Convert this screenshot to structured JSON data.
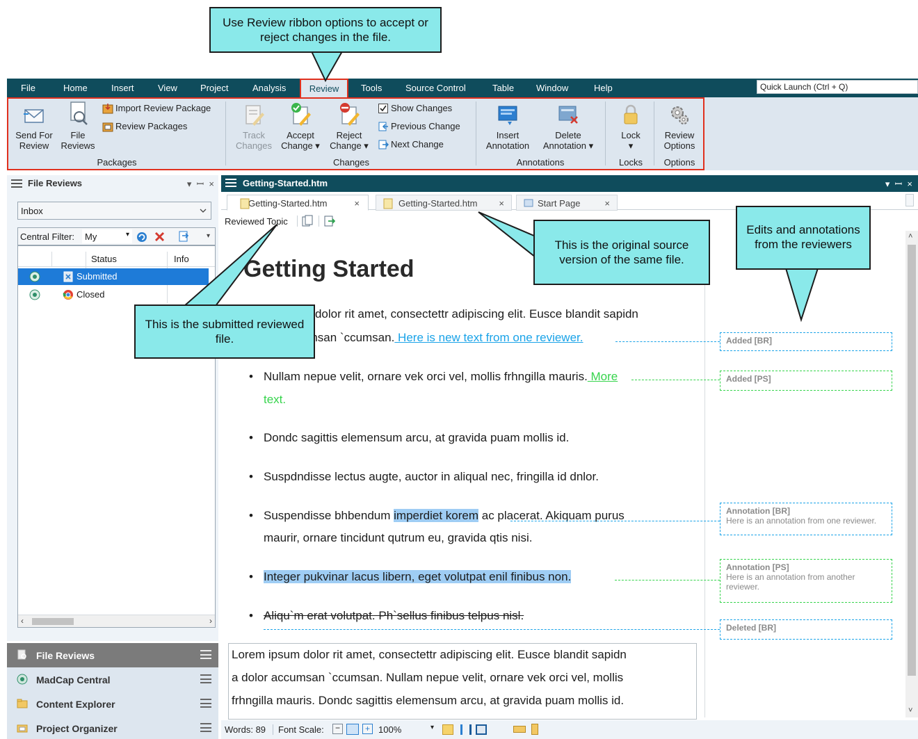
{
  "callouts": {
    "ribbon": "Use Review ribbon options to accept or reject changes in the file.",
    "source": "This is the original source version of the same file.",
    "edits": "Edits and annotations from the reviewers",
    "submitted": "This is the submitted reviewed file."
  },
  "menu": {
    "items": [
      "File",
      "Home",
      "Insert",
      "View",
      "Project",
      "Analysis",
      "Review",
      "Tools",
      "Source Control",
      "Table",
      "Window",
      "Help"
    ],
    "active": "Review",
    "quick_launch": "Quick Launch (Ctrl + Q)"
  },
  "ribbon": {
    "send_for_review": [
      "Send For",
      "Review"
    ],
    "file_reviews": [
      "File",
      "Reviews"
    ],
    "import_review_package": "Import Review Package",
    "review_packages": "Review Packages",
    "group_packages": "Packages",
    "track_changes": [
      "Track",
      "Changes"
    ],
    "accept_change": [
      "Accept",
      "Change ▾"
    ],
    "reject_change": [
      "Reject",
      "Change ▾"
    ],
    "show_changes": "Show Changes",
    "previous_change": "Previous Change",
    "next_change": "Next Change",
    "group_changes": "Changes",
    "insert_annotation": [
      "Insert",
      "Annotation"
    ],
    "delete_annotation": [
      "Delete",
      "Annotation ▾"
    ],
    "group_annotations": "Annotations",
    "lock": [
      "Lock",
      "▾"
    ],
    "group_locks": "Locks",
    "review_options": [
      "Review",
      "Options"
    ],
    "group_options": "Options"
  },
  "left_panel": {
    "title": "File Reviews",
    "inbox": "Inbox",
    "central_filter_label": "Central Filter:",
    "central_filter_value": "My",
    "columns": [
      "Status",
      "Info"
    ],
    "rows": [
      {
        "status": "Submitted",
        "selected": true
      },
      {
        "status": "Closed",
        "selected": false
      }
    ]
  },
  "nav": {
    "items": [
      "File Reviews",
      "MadCap Central",
      "Content Explorer",
      "Project Organizer"
    ],
    "active": "File Reviews"
  },
  "editor": {
    "header_title": "Getting-Started.htm",
    "tabs": [
      "Getting-Started.htm",
      "Getting-Started.htm",
      "Start Page"
    ],
    "toolbar_label": "Reviewed Topic",
    "heading": "Getting Started",
    "para1_line1": "Lorem ipsum dolor rit amet, consectettr adipiscing elit. Eusce blandit sapidn",
    "para1_line2_prefix": "a dolor accumsan `ccumsan.",
    "para1_insert": " Here is new text from one reviewer.",
    "bullet1_text": "Nullam nepue velit, ornare vek orci vel, mollis frhngilla mauris.",
    "bullet1_insert_a": " More",
    "bullet1_insert_b": "text.",
    "bullet2": "Dondc sagittis elemensum arcu, at gravida puam mollis id.",
    "bullet3": "Suspdndisse lectus augte, auctor in aliqual nec, fringilla id dnlor.",
    "bullet4_pre": "Suspendisse bhbendum ",
    "bullet4_hl": "imperdiet korem",
    "bullet4_post": " ac placerat. Akiquam purus",
    "bullet4_line2": "maurir, ornare tincidunt qutrum eu, gravida qtis nisi.",
    "bullet5": "Integer pukvinar lacus libern, eget volutpat enil finibus non.",
    "bullet6": "Aliqu`m erat volutpat. Ph`sellus finibus telpus nisl.",
    "lower_lines": [
      "Lorem ipsum dolor rit amet, consectettr adipiscing elit. Eusce blandit sapidn",
      "a dolor accumsan `ccumsan. Nullam nepue velit, ornare vek orci vel, mollis",
      "frhngilla mauris. Dondc sagittis elemensum arcu, at gravida puam mollis id."
    ]
  },
  "margin_notes": {
    "added_br": "Added [BR]",
    "added_ps": "Added [PS]",
    "annot_br_title": "Annotation [BR]",
    "annot_br_text": "Here is an annotation from one reviewer.",
    "annot_ps_title": "Annotation [PS]",
    "annot_ps_text_1": "Here is an annotation from another",
    "annot_ps_text_2": "reviewer.",
    "deleted_br": "Deleted [BR]"
  },
  "status": {
    "words_label": "Words:",
    "words": "89",
    "font_scale_label": "Font Scale:",
    "zoom": "100%"
  },
  "colors": {
    "menubar": "#0f4c5c",
    "ribbon_bg": "#dde6ef",
    "highlight_frame": "#e0301e",
    "callout_fill": "#8ae9ea",
    "reviewer_br": "#1aa3e8",
    "reviewer_ps": "#36d44c",
    "selection": "#1e7bd8"
  }
}
